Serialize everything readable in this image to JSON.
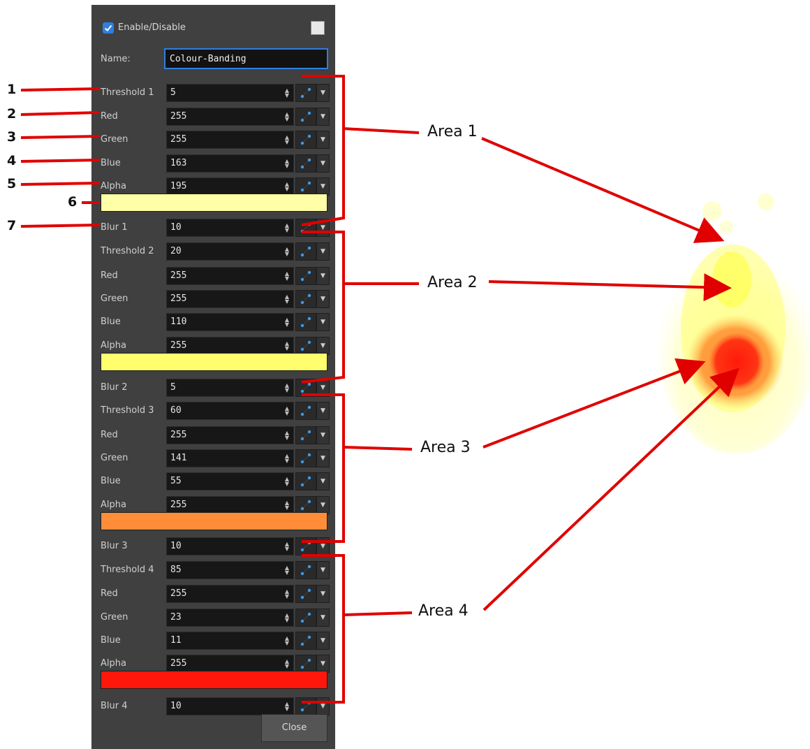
{
  "panel": {
    "enable_label": "Enable/Disable",
    "enabled": true,
    "name_label": "Name:",
    "name_value": "Colour-Banding",
    "close_label": "Close"
  },
  "rows": [
    {
      "kind": "field",
      "label": "Threshold 1",
      "value": "5"
    },
    {
      "kind": "field",
      "label": "Red",
      "value": "255"
    },
    {
      "kind": "field",
      "label": "Green",
      "value": "255"
    },
    {
      "kind": "field",
      "label": "Blue",
      "value": "163"
    },
    {
      "kind": "field",
      "label": "Alpha",
      "value": "195"
    },
    {
      "kind": "swatch",
      "color": "#ffffa8"
    },
    {
      "kind": "field",
      "label": "Blur 1",
      "value": "10"
    },
    {
      "kind": "field",
      "label": "Threshold 2",
      "value": "20"
    },
    {
      "kind": "field",
      "label": "Red",
      "value": "255"
    },
    {
      "kind": "field",
      "label": "Green",
      "value": "255"
    },
    {
      "kind": "field",
      "label": "Blue",
      "value": "110"
    },
    {
      "kind": "field",
      "label": "Alpha",
      "value": "255"
    },
    {
      "kind": "swatch",
      "color": "#ffff6e"
    },
    {
      "kind": "field",
      "label": "Blur 2",
      "value": "5"
    },
    {
      "kind": "field",
      "label": "Threshold 3",
      "value": "60"
    },
    {
      "kind": "field",
      "label": "Red",
      "value": "255"
    },
    {
      "kind": "field",
      "label": "Green",
      "value": "141"
    },
    {
      "kind": "field",
      "label": "Blue",
      "value": "55"
    },
    {
      "kind": "field",
      "label": "Alpha",
      "value": "255"
    },
    {
      "kind": "swatch",
      "color": "#ff8d37"
    },
    {
      "kind": "field",
      "label": "Blur 3",
      "value": "10"
    },
    {
      "kind": "field",
      "label": "Threshold 4",
      "value": "85"
    },
    {
      "kind": "field",
      "label": "Red",
      "value": "255"
    },
    {
      "kind": "field",
      "label": "Green",
      "value": "23"
    },
    {
      "kind": "field",
      "label": "Blue",
      "value": "11"
    },
    {
      "kind": "field",
      "label": "Alpha",
      "value": "255"
    },
    {
      "kind": "swatch",
      "color": "#ff170b"
    },
    {
      "kind": "field",
      "label": "Blur 4",
      "value": "10"
    }
  ],
  "callouts": [
    "1",
    "2",
    "3",
    "4",
    "5",
    "6",
    "7"
  ],
  "areas": [
    "Area 1",
    "Area 2",
    "Area 3",
    "Area 4"
  ],
  "colors": {
    "accent": "#2f7ee0",
    "annotation": "#e00000"
  }
}
